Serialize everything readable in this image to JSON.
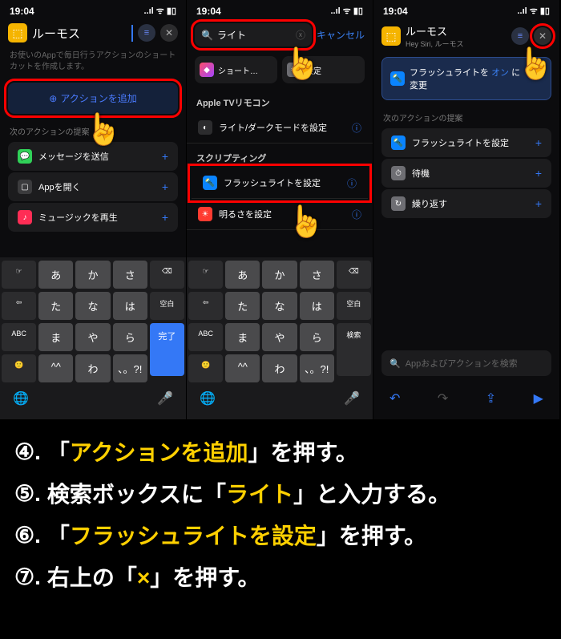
{
  "status": {
    "time": "19:04",
    "signal": "􀙇",
    "wifi": "􀙈",
    "battery": "􀛨"
  },
  "phone1": {
    "title": "ルーモス",
    "hint": "お使いのAppで毎日行うアクションのショートカットを作成します。",
    "add_action": "アクションを追加",
    "section": "次のアクションの提案",
    "items": [
      {
        "label": "メッセージを送信",
        "icon_bg": "#30d158"
      },
      {
        "label": "Appを開く",
        "icon_bg": "#3b3b3d"
      },
      {
        "label": "ミュージックを再生",
        "icon_bg": "#ff2d55"
      }
    ]
  },
  "phone2": {
    "search": "ライト",
    "cancel": "キャンセル",
    "chips": [
      {
        "label": "ショート…"
      },
      {
        "label": "設定"
      }
    ],
    "section1": "Apple TVリモコン",
    "item1": "ライト/ダークモードを設定",
    "section2": "スクリプティング",
    "item2": "フラッシュライトを設定",
    "item3": "明るさを設定"
  },
  "phone3": {
    "title": "ルーモス",
    "subtitle": "Hey Siri, ルーモス",
    "action_prefix": "フラッシュライトを",
    "action_state": "オン",
    "action_suffix": "に",
    "action_line2": "変更",
    "section": "次のアクションの提案",
    "items": [
      {
        "label": "フラッシュライトを設定",
        "icon_bg": "#0a84ff"
      },
      {
        "label": "待機",
        "icon_bg": "#6e6e73"
      },
      {
        "label": "繰り返す",
        "icon_bg": "#6e6e73"
      }
    ],
    "search_ph": "Appおよびアクションを検索"
  },
  "keyboard": {
    "rows": [
      [
        "☞",
        "あ",
        "か",
        "さ",
        "⌫"
      ],
      [
        "⇦",
        "た",
        "な",
        "は",
        "空白"
      ],
      [
        "ABC",
        "ま",
        "や",
        "ら"
      ],
      [
        "🙂",
        "^^",
        "わ",
        "、。?!"
      ]
    ],
    "done": "完了",
    "search": "検索"
  },
  "steps": [
    {
      "num": "④.",
      "pre": "「",
      "hl": "アクションを追加",
      "post": "」を押す。"
    },
    {
      "num": "⑤.",
      "pre": "検索ボックスに「",
      "hl": "ライト",
      "post": "」と入力する。"
    },
    {
      "num": "⑥.",
      "pre": "「",
      "hl": "フラッシュライトを設定",
      "post": "」を押す。"
    },
    {
      "num": "⑦.",
      "pre": "右上の「",
      "hl": "×",
      "post": "」を押す。"
    }
  ]
}
